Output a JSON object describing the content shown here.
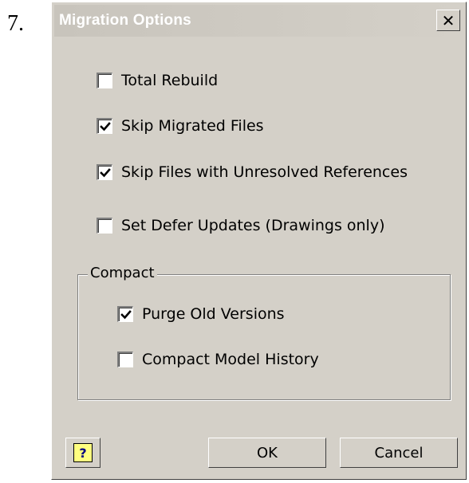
{
  "step_number": "7.",
  "dialog": {
    "title": "Migration Options",
    "close_glyph": "✕"
  },
  "options": [
    {
      "label": "Total Rebuild",
      "checked": false
    },
    {
      "label": "Skip Migrated Files",
      "checked": true
    },
    {
      "label": "Skip Files with Unresolved References",
      "checked": true
    },
    {
      "label": "Set Defer Updates (Drawings only)",
      "checked": false
    }
  ],
  "compact_group": {
    "label": "Compact",
    "options": [
      {
        "label": "Purge Old Versions",
        "checked": true
      },
      {
        "label": "Compact Model History",
        "checked": false
      }
    ]
  },
  "buttons": {
    "help_glyph": "?",
    "ok": "OK",
    "cancel": "Cancel"
  }
}
